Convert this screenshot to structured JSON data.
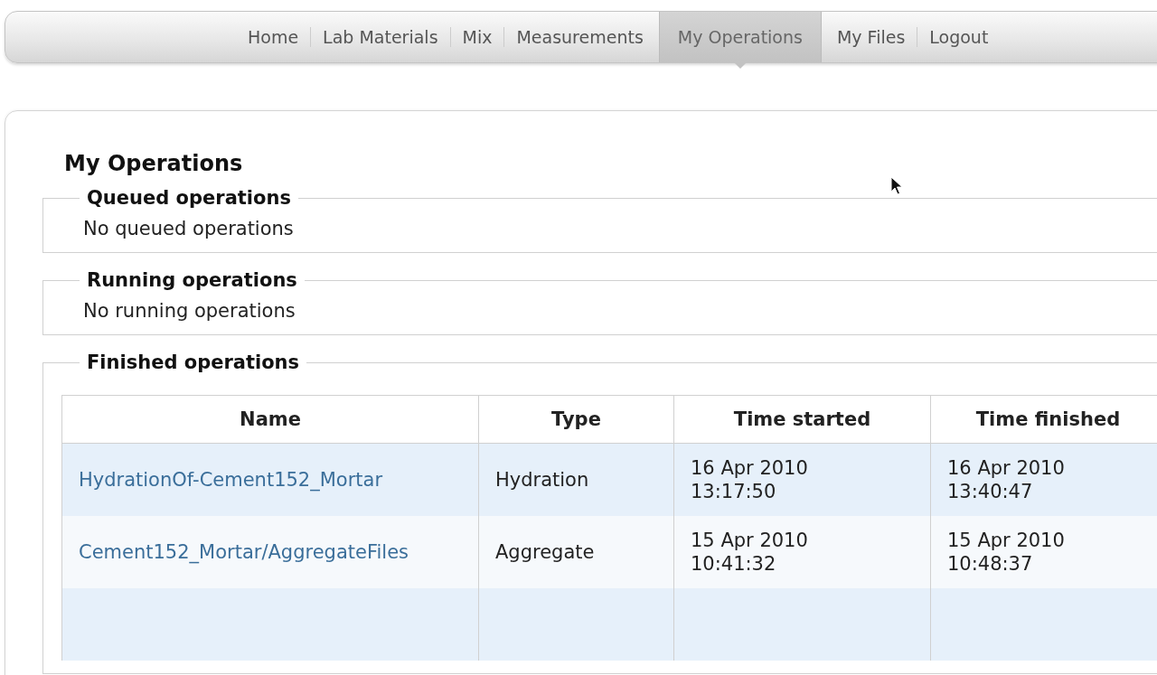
{
  "nav": {
    "items": [
      {
        "label": "Home",
        "selected": false
      },
      {
        "label": "Lab Materials",
        "selected": false
      },
      {
        "label": "Mix",
        "selected": false
      },
      {
        "label": "Measurements",
        "selected": false
      },
      {
        "label": "My Operations",
        "selected": true
      },
      {
        "label": "My Files",
        "selected": false
      },
      {
        "label": "Logout",
        "selected": false
      }
    ]
  },
  "page": {
    "title": "My Operations"
  },
  "sections": [
    {
      "kind": "message",
      "legend": "Queued operations",
      "message": "No queued operations"
    },
    {
      "kind": "message",
      "legend": "Running operations",
      "message": "No running operations"
    },
    {
      "kind": "table",
      "legend": "Finished operations",
      "table": {
        "columns": [
          "Name",
          "Type",
          "Time started",
          "Time finished"
        ],
        "rows": [
          {
            "name": "HydrationOf-Cement152_Mortar",
            "type": "Hydration",
            "started": [
              "16 Apr 2010",
              "13:17:50"
            ],
            "finished": [
              "16 Apr 2010",
              "13:40:47"
            ]
          },
          {
            "name": "Cement152_Mortar/AggregateFiles",
            "type": "Aggregate",
            "started": [
              "15 Apr 2010",
              "10:41:32"
            ],
            "finished": [
              "15 Apr 2010",
              "10:48:37"
            ]
          }
        ]
      }
    }
  ]
}
